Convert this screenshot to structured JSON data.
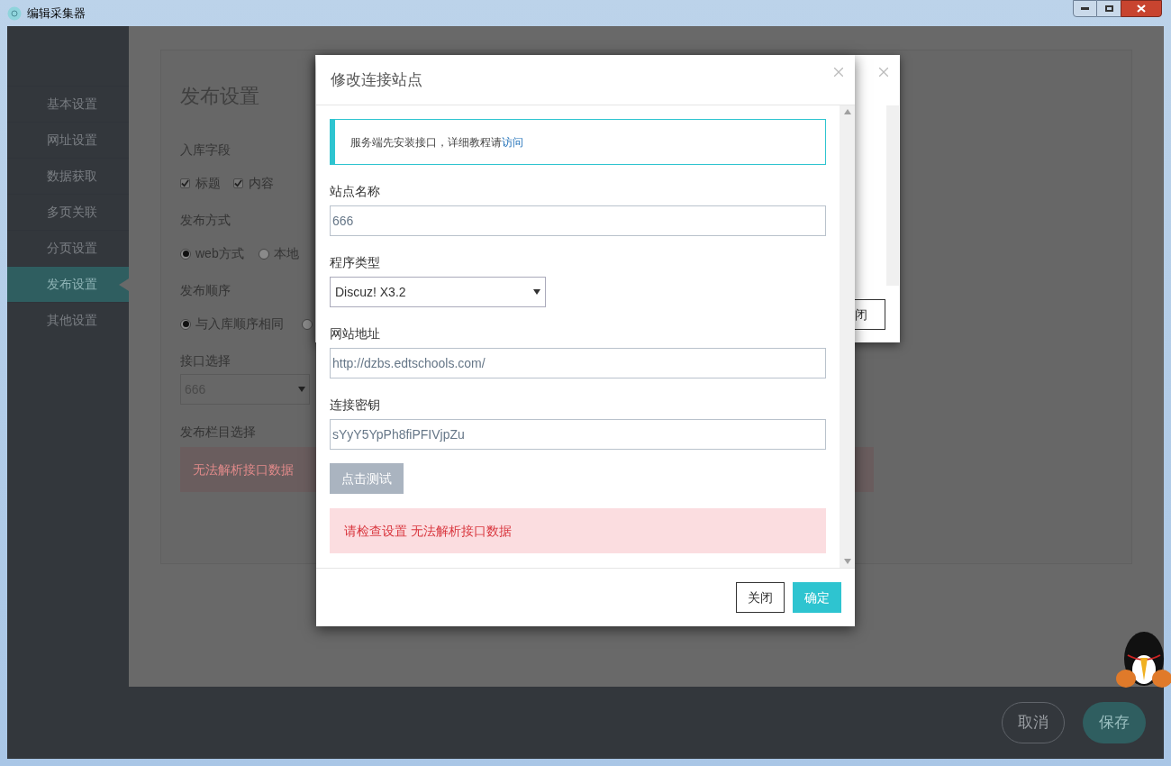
{
  "window": {
    "title": "编辑采集器"
  },
  "sidebar": {
    "items": [
      {
        "label": "基本设置",
        "selected": false
      },
      {
        "label": "网址设置",
        "selected": false
      },
      {
        "label": "数据获取",
        "selected": false
      },
      {
        "label": "多页关联",
        "selected": false
      },
      {
        "label": "分页设置",
        "selected": false
      },
      {
        "label": "发布设置",
        "selected": true
      },
      {
        "label": "其他设置",
        "selected": false
      }
    ]
  },
  "page": {
    "title": "发布设置",
    "fields_label": "入库字段",
    "fields": [
      {
        "label": "标题",
        "checked": true
      },
      {
        "label": "内容",
        "checked": true
      }
    ],
    "method_label": "发布方式",
    "methods": [
      {
        "label": "web方式",
        "selected": true
      },
      {
        "label": "本地",
        "selected": false
      }
    ],
    "order_label": "发布顺序",
    "orders": [
      {
        "label": "与入库顺序相同",
        "selected": true
      },
      {
        "selected": false
      }
    ],
    "interface_label": "接口选择",
    "interface_value": "666",
    "column_label": "发布栏目选择",
    "column_error": "无法解析接口数据"
  },
  "back_dialog": {
    "close_button": "闭"
  },
  "dialog": {
    "title": "修改连接站点",
    "notice": "服务端先安装接口，详细教程请",
    "notice_link": "访问",
    "fields": [
      {
        "kind": "text",
        "label": "站点名称",
        "value": "666"
      },
      {
        "kind": "select",
        "label": "程序类型",
        "value": "Discuz! X3.2"
      },
      {
        "kind": "text",
        "label": "网站地址",
        "value": "http://dzbs.edtschools.com/"
      },
      {
        "kind": "text",
        "label": "连接密钥",
        "value": "sYyY5YpPh8fiPFIVjpZu"
      }
    ],
    "test_button": "点击测试",
    "error": "请检查设置 无法解析接口数据",
    "buttons": [
      {
        "kind": "close",
        "label": "关闭"
      },
      {
        "kind": "confirm",
        "label": "确定"
      }
    ]
  },
  "footer": {
    "buttons": [
      {
        "kind": "cancel",
        "label": "取消"
      },
      {
        "kind": "save",
        "label": "保存"
      }
    ]
  }
}
